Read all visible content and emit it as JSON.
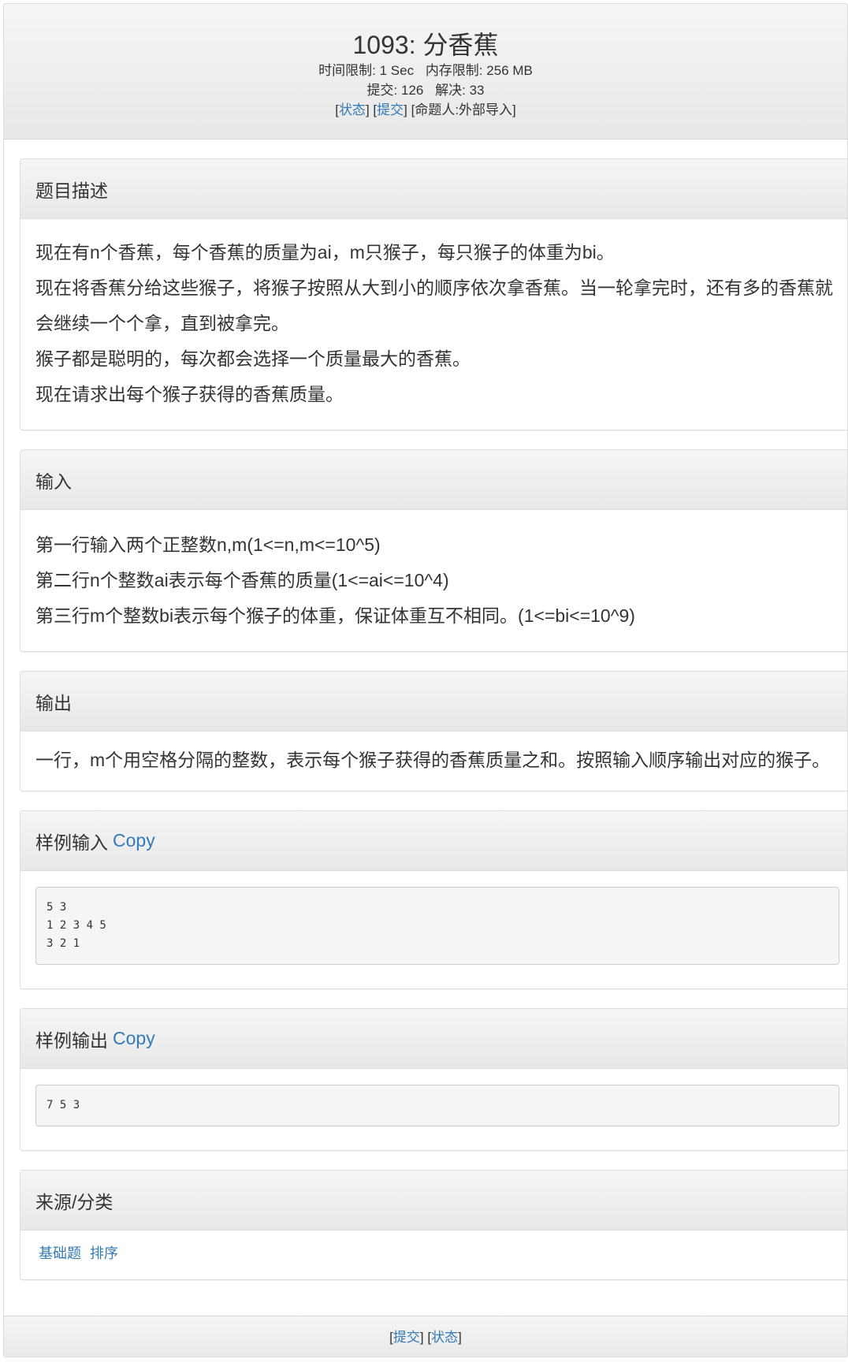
{
  "header": {
    "title": "1093: 分香蕉",
    "time_limit_label": "时间限制:",
    "time_limit_value": "1 Sec",
    "memory_limit_label": "内存限制:",
    "memory_limit_value": "256 MB",
    "submit_count_label": "提交:",
    "submit_count_value": "126",
    "solved_label": "解决:",
    "solved_value": "33",
    "status_link": "状态",
    "submit_link": "提交",
    "author_text": "[命题人:外部导入]"
  },
  "description": {
    "heading": "题目描述",
    "lines": [
      "现在有n个香蕉，每个香蕉的质量为ai，m只猴子，每只猴子的体重为bi。",
      "现在将香蕉分给这些猴子，将猴子按照从大到小的顺序依次拿香蕉。当一轮拿完时，还有多的香蕉就会继续一个个拿，直到被拿完。",
      "猴子都是聪明的，每次都会选择一个质量最大的香蕉。",
      "现在请求出每个猴子获得的香蕉质量。"
    ]
  },
  "input": {
    "heading": "输入",
    "lines": [
      "第一行输入两个正整数n,m(1<=n,m<=10^5)",
      "第二行n个整数ai表示每个香蕉的质量(1<=ai<=10^4)",
      "第三行m个整数bi表示每个猴子的体重，保证体重互不相同。(1<=bi<=10^9)"
    ]
  },
  "output": {
    "heading": "输出",
    "text": "一行，m个用空格分隔的整数，表示每个猴子获得的香蕉质量之和。按照输入顺序输出对应的猴子。"
  },
  "sample_input": {
    "heading": "样例输入",
    "copy_label": "Copy",
    "content": "5 3\n1 2 3 4 5\n3 2 1"
  },
  "sample_output": {
    "heading": "样例输出",
    "copy_label": "Copy",
    "content": "7 5 3"
  },
  "source": {
    "heading": "来源/分类",
    "tags": [
      "基础题",
      "排序"
    ]
  },
  "footer": {
    "submit_link": "提交",
    "status_link": "状态"
  }
}
